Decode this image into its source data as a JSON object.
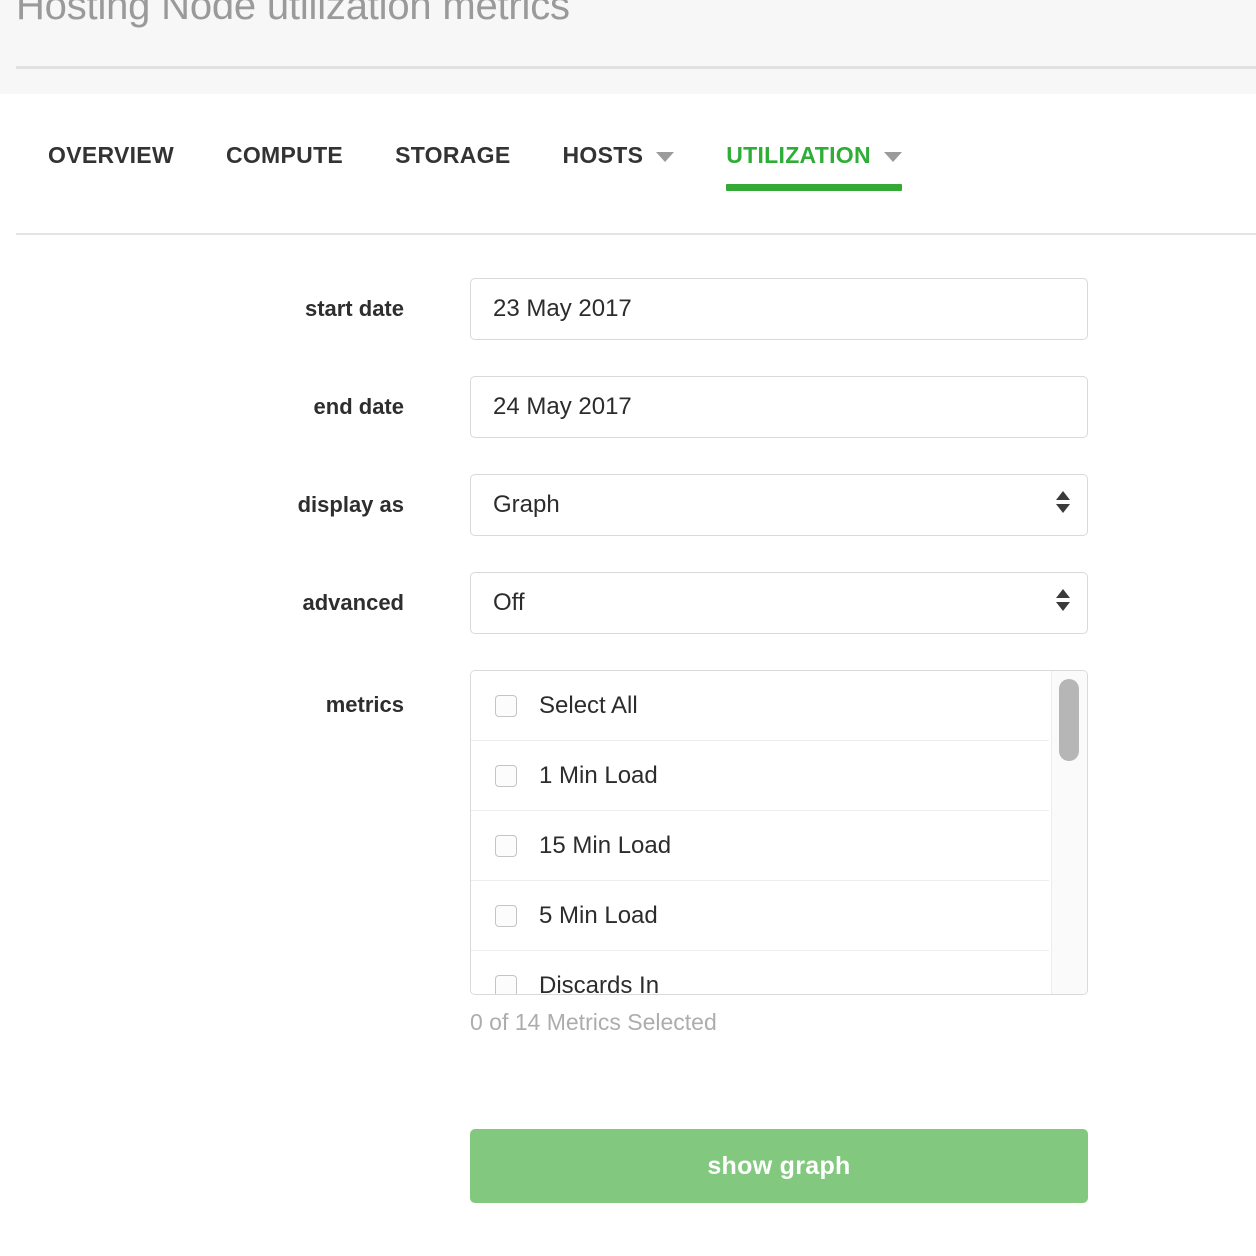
{
  "header": {
    "title": "Hosting Node utilization metrics"
  },
  "tabs": [
    {
      "label": "OVERVIEW",
      "active": false,
      "has_caret": false
    },
    {
      "label": "COMPUTE",
      "active": false,
      "has_caret": false
    },
    {
      "label": "STORAGE",
      "active": false,
      "has_caret": false
    },
    {
      "label": "HOSTS",
      "active": false,
      "has_caret": true
    },
    {
      "label": "UTILIZATION",
      "active": true,
      "has_caret": true
    }
  ],
  "form": {
    "start_date": {
      "label": "start date",
      "value": "23 May 2017",
      "placeholder": "start date"
    },
    "end_date": {
      "label": "end date",
      "value": "24 May 2017",
      "placeholder": "end date"
    },
    "display_as": {
      "label": "display as",
      "value": "Graph"
    },
    "advanced": {
      "label": "advanced",
      "value": "Off"
    },
    "metrics": {
      "label": "metrics",
      "items": [
        {
          "label": "Select All",
          "checked": false
        },
        {
          "label": "1 Min Load",
          "checked": false
        },
        {
          "label": "15 Min Load",
          "checked": false
        },
        {
          "label": "5 Min Load",
          "checked": false
        },
        {
          "label": "Discards In",
          "checked": false
        }
      ],
      "status": "0 of 14 Metrics Selected"
    }
  },
  "actions": {
    "show_graph_label": "show graph"
  },
  "colors": {
    "accent_green": "#2ead37",
    "underline_green": "#35a935",
    "button_green": "#82c97f",
    "title_gray": "#9a9a9a",
    "status_gray": "#adadad",
    "header_bg": "#f7f7f7"
  }
}
